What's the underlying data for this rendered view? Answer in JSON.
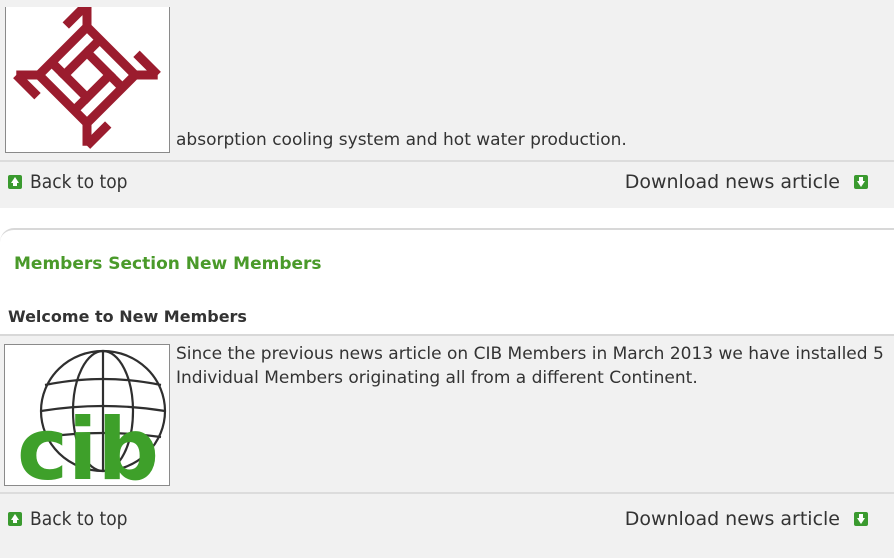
{
  "top_article": {
    "text": "absorption cooling system and hot water production.",
    "logo_icon": "polyu-logo"
  },
  "bar1": {
    "back_label": "Back to top",
    "download_label": "Download news article"
  },
  "members_section": {
    "title": "Members Section New Members",
    "subtitle": "Welcome to New Members",
    "logo_icon": "cib-logo",
    "body": "Since the previous news article on CIB Members in March 2013 we have installed 5 Individual Members originating all from a different Continent."
  },
  "bar2": {
    "back_label": "Back to top",
    "download_label": "Download news article"
  },
  "colors": {
    "accent_green": "#4a9a2a",
    "logo_red": "#9b1c2e",
    "icon_green": "#3a9a2f"
  }
}
